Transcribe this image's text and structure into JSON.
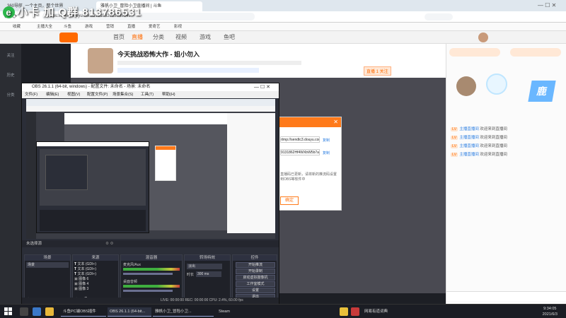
{
  "browser": {
    "tabs": [
      "360导航_一个主页，整个世界",
      "雅帆小卫_冒险小卫直播间 | 斗鱼"
    ],
    "url": "https://www.douyu.com/9131862913935049",
    "bookmarks": [
      "收藏",
      "主播大全",
      "斗鱼",
      "游戏",
      "营销",
      "直播",
      "爱奇艺",
      "影视"
    ]
  },
  "site": {
    "nav": [
      "首页",
      "直播",
      "分类",
      "视频",
      "游戏",
      "鱼吧"
    ],
    "stream_title": "今天挑战恐怖大作 - 姐小勿入",
    "follow_label": "关注",
    "sidebar": [
      "关注",
      "历史",
      "分类"
    ],
    "live_badge": "直播 1 关注"
  },
  "watermark": {
    "e_icon": "e",
    "text": "小卡 加 Q群 813786531"
  },
  "chat": [
    {
      "badge": "LV",
      "name": "主播直播间",
      "msg": "欢迎来到直播间"
    },
    {
      "badge": "LV",
      "name": "主播直播间",
      "msg": "欢迎来到直播间"
    },
    {
      "badge": "LV",
      "name": "主播直播间",
      "msg": "欢迎来到直播间"
    },
    {
      "badge": "LV",
      "name": "主播直播间",
      "msg": "欢迎来到直播间"
    }
  ],
  "obs": {
    "title": "OBS 26.1.1 (64-bit, windows) - 配置文件: 未命名 - 场景: 未命名",
    "menu": [
      "文件(F)",
      "编辑(E)",
      "视图(V)",
      "配置文件(P)",
      "场景集合(S)",
      "工具(T)",
      "帮助(H)"
    ],
    "source_bar": "未选择源",
    "docks": {
      "scenes": "场景",
      "sources": "来源",
      "mixer": "混音器",
      "transitions": "转场特效",
      "controls": "控件"
    },
    "scene_item": "场景",
    "sources_list": [
      "文本 (GDI+)",
      "文本 (GDI+)",
      "文本 (GDI+)",
      "图像 6",
      "图像 4",
      "图像 3"
    ],
    "mixer_labels": [
      "桌面音频",
      "麦克风/Aux"
    ],
    "transition": {
      "value": "淡出",
      "duration_label": "时长",
      "duration": "300 ms"
    },
    "controls": [
      "开始推流",
      "开始录制",
      "启动虚拟摄像机",
      "工作室模式",
      "设置",
      "退出"
    ],
    "status": "LIVE: 00:00:00   REC: 00:00:00   CPU: 2.4%, 60.00 fps"
  },
  "dialog": {
    "url_field": "rtmp://sendtc3.douyu.com/live",
    "key_field": "9131862Hf4WXbW5b7a8DeTeaSecret=********",
    "copy_label": "复制",
    "hint": "直播码已更新，请将新的推流码设置到OBS等软件中",
    "button": "确定"
  },
  "taskbar": {
    "items": [
      "斗鱼PC端OBS插件",
      "OBS 26.1.1 (64-bit...",
      "雅帆小卫_冒险小卫...",
      "Steam",
      "网易有道词典"
    ],
    "time": "9:34:05",
    "date": "2021/6/3"
  },
  "colors": {
    "accent": "#ff6a00",
    "obs_bg": "#2b2e38"
  }
}
